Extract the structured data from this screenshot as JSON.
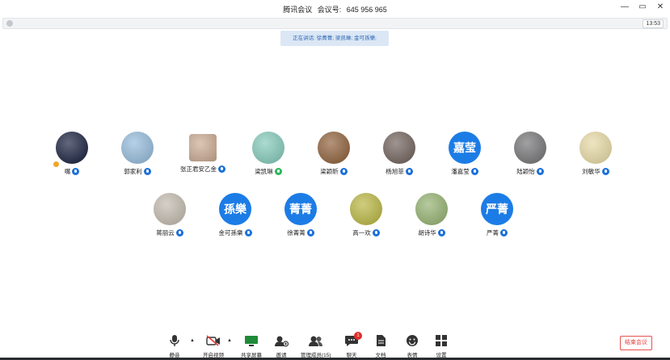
{
  "window": {
    "app_name": "腾讯会议",
    "meeting_id_label": "会议号:",
    "meeting_id": "645 956 965",
    "controls": [
      "—",
      "▭",
      "✕"
    ]
  },
  "statusbar": {
    "time": "13:53"
  },
  "speaking": {
    "text": "正在讲话: 徐菁菁; 梁凯琳; 金可孫樂;"
  },
  "participants": {
    "row1": [
      {
        "name": "嘴",
        "avatar": "photo",
        "color": "#0f1736",
        "mic": "blue",
        "host": true
      },
      {
        "name": "郭家利",
        "avatar": "photo",
        "color": "#8fb7d8",
        "mic": "blue"
      },
      {
        "name": "张正君安乙金",
        "avatar": "photo-square",
        "color": "#c9a88f",
        "mic": "blue"
      },
      {
        "name": "梁凯琳",
        "avatar": "photo",
        "color": "#7ec7b6",
        "mic": "green"
      },
      {
        "name": "梁颖昕",
        "avatar": "photo",
        "color": "#8a5a32",
        "mic": "blue"
      },
      {
        "name": "杨旭菲",
        "avatar": "photo",
        "color": "#6b5b55",
        "mic": "blue"
      },
      {
        "name": "潘嘉莹",
        "avatar": "text",
        "text": "嘉莹",
        "mic": "blue"
      },
      {
        "name": "陆颖怡",
        "avatar": "photo",
        "color": "#6e6e70",
        "mic": "blue"
      },
      {
        "name": "刘敏华",
        "avatar": "photo",
        "color": "#e5d7a0",
        "mic": "blue"
      }
    ],
    "row2": [
      {
        "name": "蒋丽云",
        "avatar": "photo",
        "color": "#bfb6aa",
        "mic": "blue"
      },
      {
        "name": "金可孫樂",
        "avatar": "text",
        "text": "孫樂",
        "mic": "blue"
      },
      {
        "name": "徐菁菁",
        "avatar": "text",
        "text": "菁菁",
        "mic": "blue"
      },
      {
        "name": "高一欢",
        "avatar": "photo",
        "color": "#b6b33a",
        "mic": "blue"
      },
      {
        "name": "胡诗华",
        "avatar": "photo",
        "color": "#8fae6a",
        "mic": "blue"
      },
      {
        "name": "严菁",
        "avatar": "text",
        "text": "严菁",
        "mic": "blue"
      }
    ]
  },
  "toolbar": {
    "items": [
      {
        "label": "静音",
        "icon": "microphone-icon"
      },
      {
        "label": "开启视频",
        "icon": "camera-off-icon"
      },
      {
        "label": "共享屏幕",
        "icon": "screen-share-icon"
      },
      {
        "label": "邀请",
        "icon": "invite-icon"
      },
      {
        "label": "管理成员(15)",
        "icon": "members-icon"
      },
      {
        "label": "聊天",
        "icon": "chat-icon",
        "badge": "1"
      },
      {
        "label": "文档",
        "icon": "document-icon"
      },
      {
        "label": "表情",
        "icon": "emoji-icon"
      },
      {
        "label": "设置",
        "icon": "settings-icon"
      }
    ],
    "end_label": "结束会议"
  },
  "colors": {
    "accent": "#1c7ce6",
    "end": "#e33d3a",
    "mic_active": "#2bb55b"
  }
}
